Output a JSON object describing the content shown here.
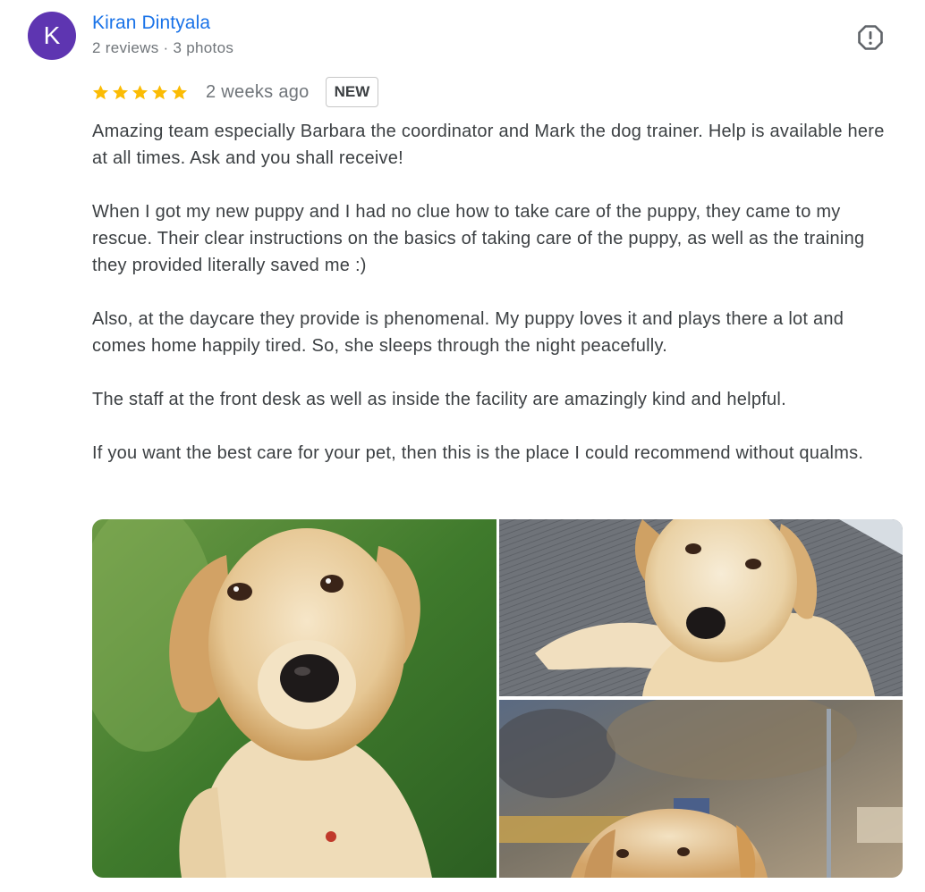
{
  "review": {
    "author": {
      "initial": "K",
      "name": "Kiran Dintyala",
      "meta": "2 reviews · 3 photos",
      "avatar_color": "#5e35b1"
    },
    "rating": 5,
    "time_ago": "2 weeks ago",
    "badge": "NEW",
    "paragraphs": [
      "Amazing team especially Barbara the coordinator and Mark the dog trainer. Help is available here at all times. Ask and you shall receive!",
      "When I got my new puppy and I had no clue how to take care of the puppy, they came to my rescue. Their clear instructions on the basics of taking care of the puppy, as well as the training they provided literally saved me :)",
      "Also, at the daycare they provide is phenomenal. My puppy loves it and plays there a lot and comes home happily tired. So, she sleeps through the night peacefully.",
      "The staff at the front desk as well as inside the facility are amazingly kind and helpful.",
      "If you want the best care for your pet, then this is the place I could recommend without qualms."
    ],
    "photos": [
      {
        "subject": "golden retriever puppy sitting on grass"
      },
      {
        "subject": "golden retriever puppy lying on grey mat"
      },
      {
        "subject": "golden retriever puppy head peeking, outdoor"
      }
    ]
  },
  "icons": {
    "report": "report-flag-icon",
    "star": "star-icon"
  },
  "colors": {
    "link": "#1a73e8",
    "star": "#fbbc04",
    "text": "#3c4043",
    "muted": "#70757a"
  }
}
